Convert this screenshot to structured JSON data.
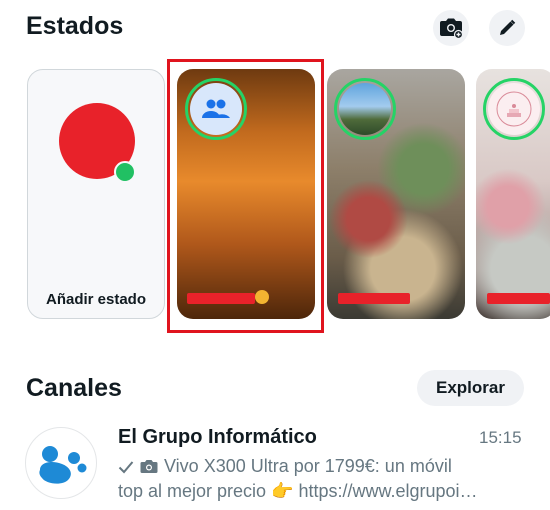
{
  "header": {
    "title": "Estados"
  },
  "status": {
    "add_label": "Añadir estado"
  },
  "channels": {
    "title": "Canales",
    "explore_label": "Explorar",
    "item": {
      "name": "El Grupo Informático",
      "time": "15:15",
      "preview_line1": "Vivo X300 Ultra por 1799€: un móvil",
      "preview_line2": "top al mejor precio 👉 https://www.elgrupoi…"
    }
  },
  "icons": {
    "camera": "camera-icon",
    "pencil": "pencil-icon",
    "group": "group-icon",
    "check": "check-icon",
    "photo": "camera-small-icon"
  },
  "colors": {
    "accent_green": "#25d366",
    "highlight_red": "#e0141e",
    "group_blue": "#1b72e8"
  }
}
